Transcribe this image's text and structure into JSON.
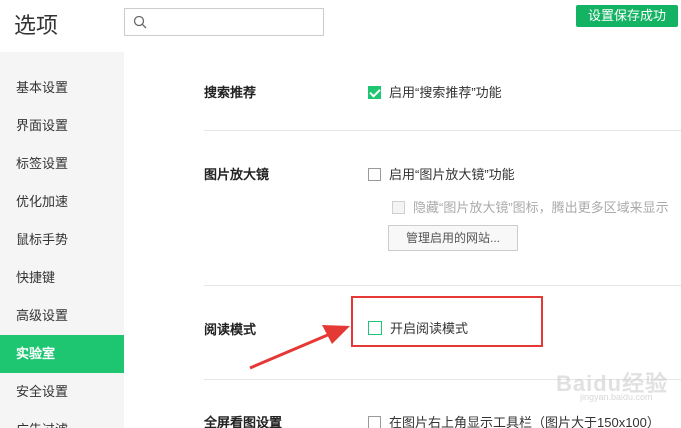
{
  "header": {
    "title": "选项",
    "search_placeholder": "",
    "save_status": "设置保存成功"
  },
  "sidebar": {
    "items": [
      {
        "label": "基本设置"
      },
      {
        "label": "界面设置"
      },
      {
        "label": "标签设置"
      },
      {
        "label": "优化加速"
      },
      {
        "label": "鼠标手势"
      },
      {
        "label": "快捷键"
      },
      {
        "label": "高级设置"
      },
      {
        "label": "实验室",
        "active": true
      },
      {
        "label": "安全设置"
      },
      {
        "label": "广告过滤"
      }
    ]
  },
  "main": {
    "sections": [
      {
        "label": "搜索推荐",
        "options": [
          {
            "label": "启用“搜索推荐”功能",
            "checked": true
          }
        ]
      },
      {
        "label": "图片放大镜",
        "options": [
          {
            "label": "启用“图片放大镜”功能",
            "checked": false
          },
          {
            "label": "隐藏“图片放大镜”图标，腾出更多区域来显示",
            "checked": false,
            "disabled": true
          }
        ],
        "button": "管理启用的网站..."
      },
      {
        "label": "阅读模式",
        "options": [
          {
            "label": "开启阅读模式",
            "checked": false
          }
        ]
      },
      {
        "label": "全屏看图设置",
        "options": [
          {
            "label": "在图片右上角显示工具栏（图片大于150x100）",
            "checked": false
          }
        ]
      }
    ]
  },
  "watermark": {
    "text": "Baidu经验",
    "sub": "jingyan.baidu.com"
  },
  "colors": {
    "accent": "#1fc672",
    "save_badge": "#14b364",
    "annotation": "#e53935"
  }
}
